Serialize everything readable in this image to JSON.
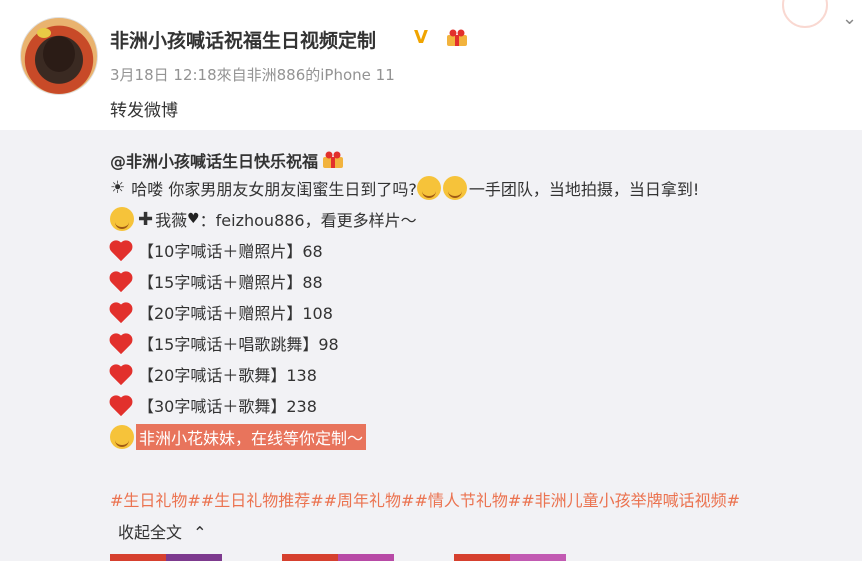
{
  "post": {
    "username": "非洲小孩喊话祝福生日视频定制",
    "verified_badge": "V",
    "meta": "3月18日 12:18來自非洲886的iPhone 11",
    "repost_text": "转发微博"
  },
  "original": {
    "username": "@非洲小孩喊话生日快乐祝福",
    "intro_a": "哈喽 你家男朋友女朋友闺蜜生日到了吗?",
    "intro_b": "一手团队，当地拍摄，当日拿到!",
    "contact_a": "我薇",
    "contact_b": "：feizhou886，看更多样片～",
    "prices": [
      "【10字喊话＋赠照片】68",
      "【15字喊话＋赠照片】88",
      "【20字喊话＋赠照片】108",
      "【15字喊话＋唱歌跳舞】98",
      "【20字喊话＋歌舞】138",
      "【30字喊话＋歌舞】238"
    ],
    "closing": "非洲小花妹妹，在线等你定制～",
    "hashtags": "#生日礼物##生日礼物推荐##周年礼物##情人节礼物##非洲儿童小孩举牌喊话视频#",
    "collapse_label": "收起全文"
  },
  "colors": {
    "link": "#eb7350",
    "highlight": "#e8745c",
    "meta": "#939393",
    "quote_bg": "#f2f2f5"
  }
}
